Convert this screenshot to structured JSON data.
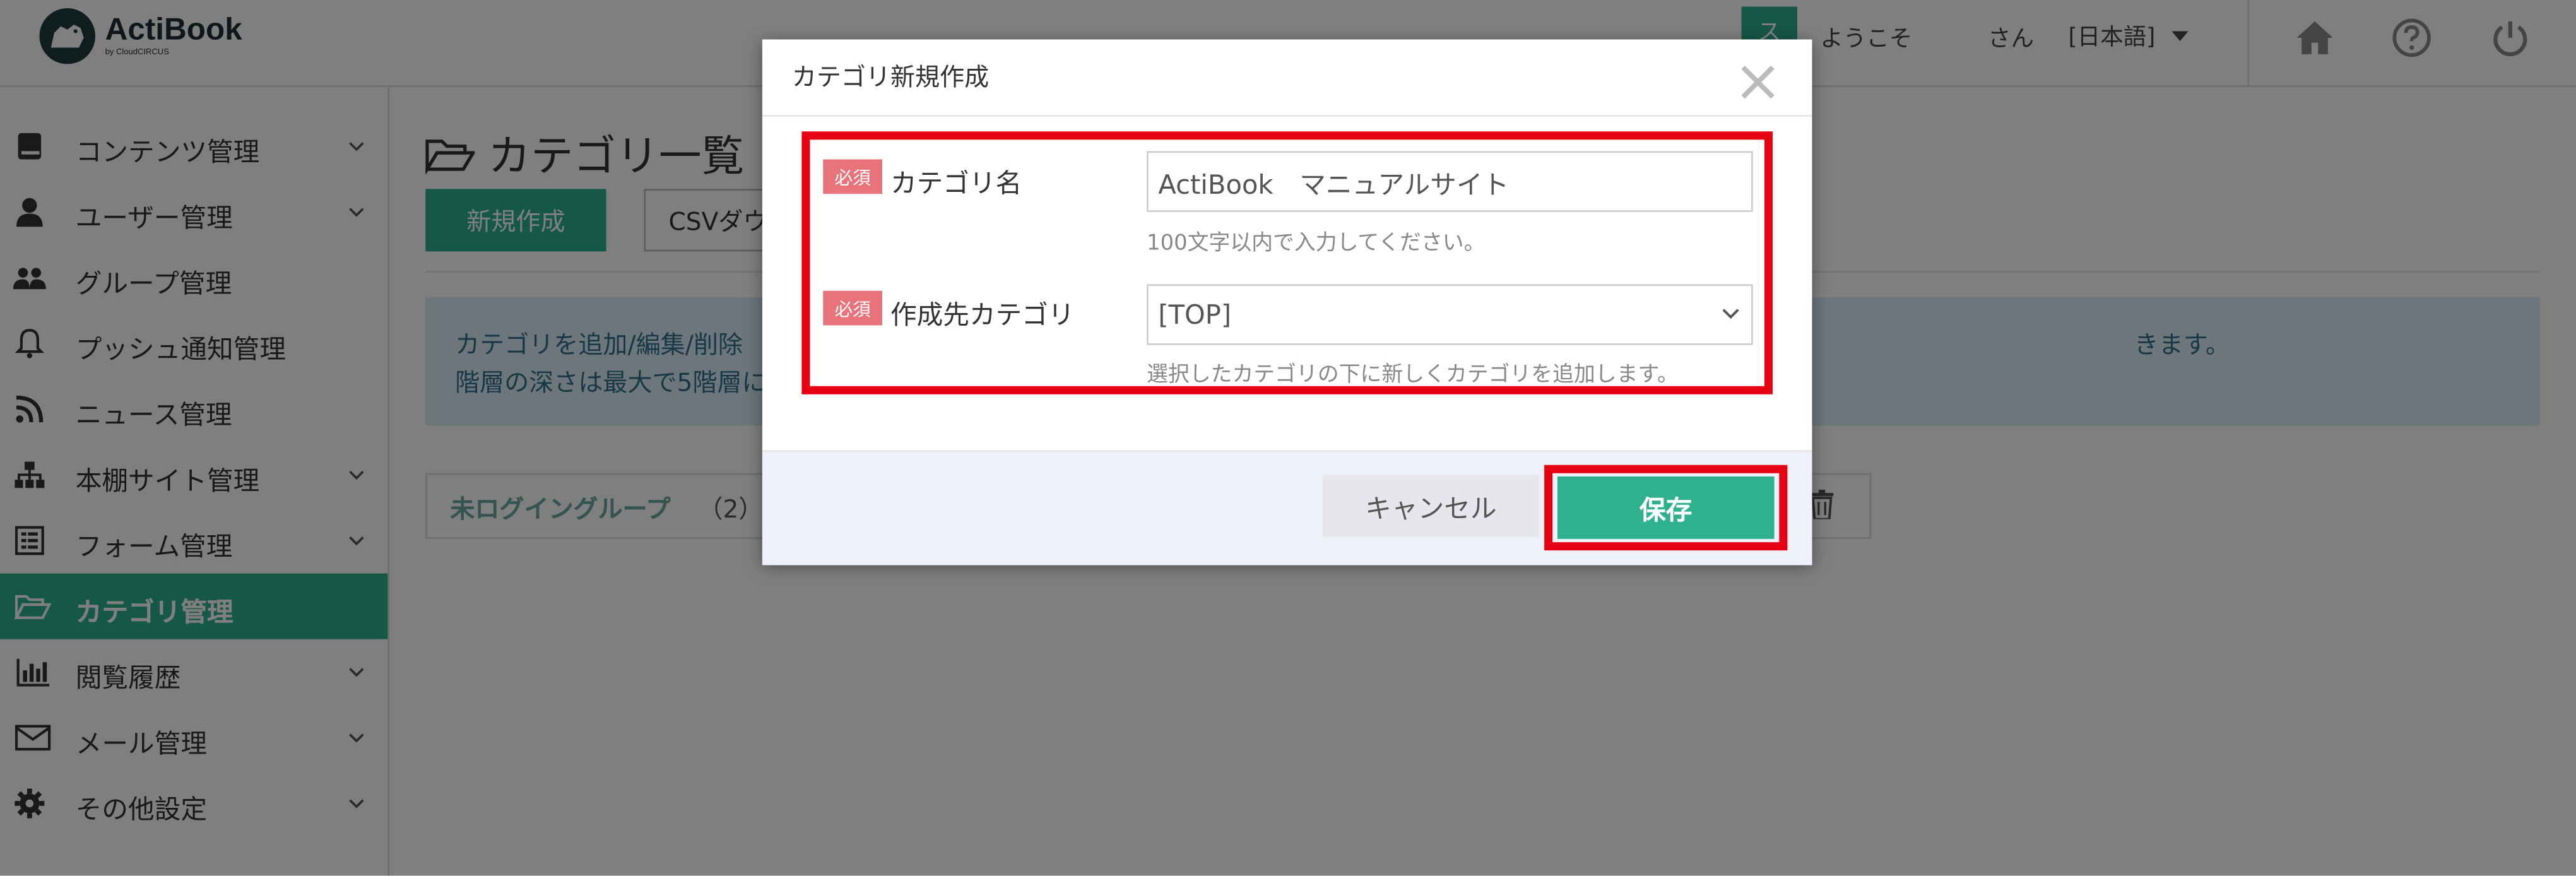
{
  "header": {
    "logo_name": "ActiBook",
    "logo_by": "by CloudCIRCUS",
    "avatar_initial": "ス",
    "welcome": "ようこそ",
    "san": "さん",
    "language": "[日本語]"
  },
  "sidebar": {
    "items": [
      {
        "label": "コンテンツ管理",
        "icon": "book-icon"
      },
      {
        "label": "ユーザー管理",
        "icon": "user-icon"
      },
      {
        "label": "グループ管理",
        "icon": "users-icon"
      },
      {
        "label": "プッシュ通知管理",
        "icon": "bell-icon"
      },
      {
        "label": "ニュース管理",
        "icon": "rss-icon"
      },
      {
        "label": "本棚サイト管理",
        "icon": "sitemap-icon"
      },
      {
        "label": "フォーム管理",
        "icon": "form-icon"
      },
      {
        "label": "カテゴリ管理",
        "icon": "folder-open-icon"
      },
      {
        "label": "閲覧履歴",
        "icon": "bar-chart-icon"
      },
      {
        "label": "メール管理",
        "icon": "envelope-icon"
      },
      {
        "label": "その他設定",
        "icon": "gear-icon"
      }
    ],
    "active_index": 7
  },
  "main": {
    "title": "カテゴリ一覧",
    "new_button": "新規作成",
    "csv_button": "CSVダウ",
    "info_line1": "カテゴリを追加/編集/削除",
    "info_line2": "階層の深さは最大で5階層に",
    "info_line1_right": "きます。",
    "group_label": "未ログイングループ",
    "group_count": "（2）"
  },
  "modal": {
    "title": "カテゴリ新規作成",
    "required_badge": "必須",
    "field_name_label": "カテゴリ名",
    "field_name_value": "ActiBook　マニュアルサイト",
    "field_name_help": "100文字以内で入力してください。",
    "field_parent_label": "作成先カテゴリ",
    "field_parent_value": "[TOP]",
    "field_parent_help": "選択したカテゴリの下に新しくカテゴリを追加します。",
    "cancel_button": "キャンセル",
    "save_button": "保存"
  },
  "colors": {
    "brand": "#2db18e",
    "highlight": "#e60012",
    "required": "#e8737a",
    "info_bg": "#d9edf7"
  }
}
